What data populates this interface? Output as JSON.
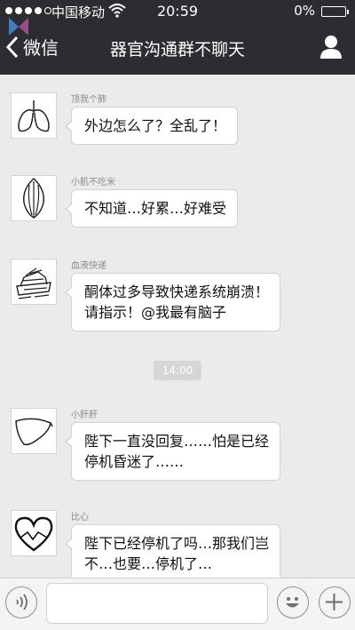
{
  "status_bar": {
    "carrier": "中国移动",
    "time": "20:59",
    "battery": "0%"
  },
  "nav": {
    "back_label": "微信",
    "title": "器官沟通群不聊天"
  },
  "messages": [
    {
      "sender": "顶我个肺",
      "lines": [
        "外边怎么了？全乱了！"
      ],
      "avatar_icon": "lungs-icon"
    },
    {
      "sender": "小肌不吃米",
      "lines": [
        "不知道…好累…好难受"
      ],
      "avatar_icon": "muscle-icon"
    },
    {
      "sender": "血液快递",
      "lines": [
        "酮体过多导致快递系统崩溃！",
        "请指示！@我最有脑子"
      ],
      "avatar_icon": "blood-scribble-icon"
    },
    {
      "sender": "小肝肝",
      "lines": [
        "陛下一直没回复……怕是已经",
        "停机昏迷了……"
      ],
      "avatar_icon": "liver-icon"
    },
    {
      "sender": "比心",
      "lines": [
        "陛下已经停机了吗…那我们岂",
        "不…也要…停机了…"
      ],
      "avatar_icon": "heart-icon"
    }
  ],
  "timestamp": "14:00",
  "input": {
    "value": "",
    "placeholder": ""
  },
  "colors": {
    "header_bg": "#2b2d31",
    "chat_bg": "#ebebeb",
    "bubble_bg": "#ffffff"
  }
}
